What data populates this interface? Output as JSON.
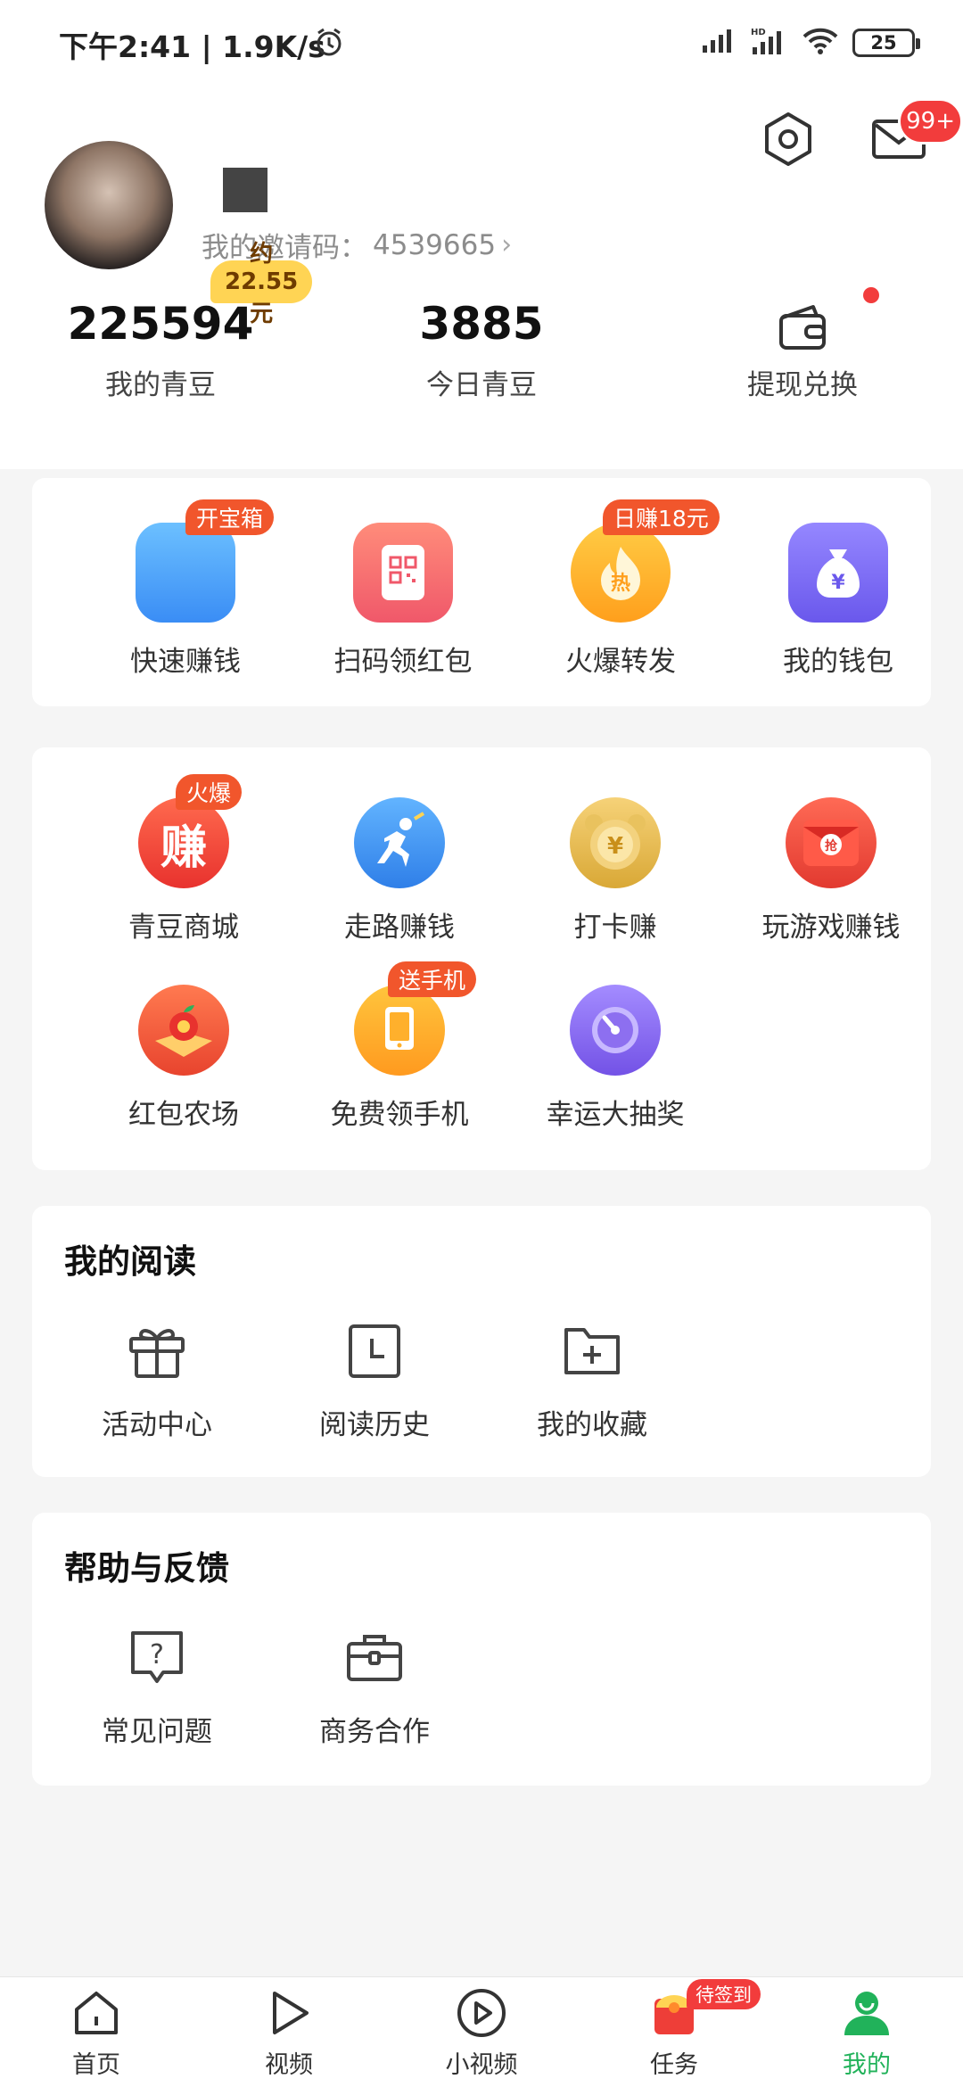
{
  "status_bar": {
    "time": "下午2:41 | 1.9K/s",
    "battery": "25"
  },
  "header": {
    "message_badge": "99+",
    "invite_label": "我的邀请码：",
    "invite_code": "4539665"
  },
  "stats": {
    "beans_value": "225594",
    "beans_label": "我的青豆",
    "beans_tag": "约22.55元",
    "today_value": "3885",
    "today_label": "今日青豆",
    "withdraw_label": "提现兑换"
  },
  "quick": {
    "items": [
      {
        "label": "快速赚钱",
        "tag": "开宝箱",
        "color": "#4aa3ff"
      },
      {
        "label": "扫码领红包",
        "tag": "",
        "color": "#f46a6a"
      },
      {
        "label": "火爆转发",
        "tag": "日赚18元",
        "color": "#ffaf2a"
      },
      {
        "label": "我的钱包",
        "tag": "",
        "color": "#7b6cf0"
      }
    ]
  },
  "features": {
    "items": [
      {
        "label": "青豆商城",
        "tag": "火爆",
        "glyph": "赚",
        "color": "#f0443a"
      },
      {
        "label": "走路赚钱",
        "tag": "",
        "glyph": "",
        "color": "#3d97ef"
      },
      {
        "label": "打卡赚",
        "tag": "",
        "glyph": "¥",
        "color": "#e6bb4a"
      },
      {
        "label": "玩游戏赚钱",
        "tag": "",
        "glyph": "抢",
        "color": "#ee4336"
      },
      {
        "label": "红包农场",
        "tag": "",
        "glyph": "",
        "color": "#f45c3c"
      },
      {
        "label": "免费领手机",
        "tag": "送手机",
        "glyph": "",
        "color": "#ffa92a"
      },
      {
        "label": "幸运大抽奖",
        "tag": "",
        "glyph": "",
        "color": "#8a6cf0"
      }
    ]
  },
  "reading": {
    "title": "我的阅读",
    "items": [
      {
        "label": "活动中心"
      },
      {
        "label": "阅读历史"
      },
      {
        "label": "我的收藏"
      }
    ]
  },
  "help": {
    "title": "帮助与反馈",
    "items": [
      {
        "label": "常见问题"
      },
      {
        "label": "商务合作"
      }
    ]
  },
  "nav": {
    "items": [
      {
        "label": "首页"
      },
      {
        "label": "视频"
      },
      {
        "label": "小视频"
      },
      {
        "label": "任务",
        "tag": "待签到"
      },
      {
        "label": "我的"
      }
    ],
    "active_color": "#21b25a"
  }
}
